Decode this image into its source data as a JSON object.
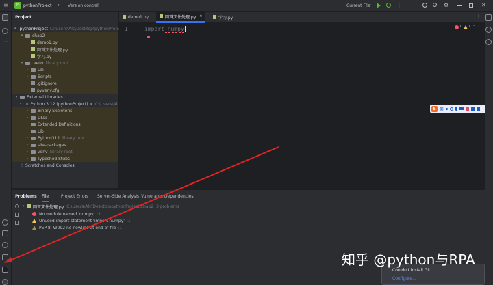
{
  "titlebar": {
    "project": "pythonProject",
    "vcs": "Version control",
    "run_config": "Current File"
  },
  "project_panel": {
    "title": "Project",
    "tree": [
      {
        "label": "pythonProject",
        "hint": "C:\\Users\\Alc\\Desktop\\pythonProject"
      },
      {
        "label": "chap2"
      },
      {
        "label": "demo1.py"
      },
      {
        "label": "回首文件处理.py"
      },
      {
        "label": "学习.py"
      },
      {
        "label": ".venv",
        "hint": "library root"
      },
      {
        "label": "Lib"
      },
      {
        "label": "Scripts"
      },
      {
        "label": ".gitignore"
      },
      {
        "label": "pyvenv.cfg"
      },
      {
        "label": "External Libraries"
      },
      {
        "label": "< Python 3.12 (pythonProject) >",
        "hint": "C:\\Users\\Alc\\Desk"
      },
      {
        "label": "Binary Skeletons"
      },
      {
        "label": "DLLs"
      },
      {
        "label": "Extended Definitions"
      },
      {
        "label": "Lib"
      },
      {
        "label": "Python312",
        "hint": "library root"
      },
      {
        "label": "site-packages"
      },
      {
        "label": "venv",
        "hint": "library root"
      },
      {
        "label": "Typeshed Stubs"
      },
      {
        "label": "Scratches and Consoles"
      }
    ]
  },
  "editor": {
    "tabs": [
      {
        "label": "demo1.py"
      },
      {
        "label": "回首文件处理.py"
      },
      {
        "label": "学习.py"
      }
    ],
    "line_number": "1",
    "code": "import numpy",
    "errors": "1",
    "warnings": "1"
  },
  "ime_bar": {
    "label": "英"
  },
  "problems": {
    "tabs": [
      "Problems",
      "File",
      "Project Errors",
      "Server-Side Analysis",
      "Vulnerable Dependencies"
    ],
    "file": {
      "name": "回首文件处理.py",
      "path": "C:\\Users\\Alc\\Desktop\\pythonProject\\chap2",
      "count": "3 problems"
    },
    "items": [
      {
        "text": "No module named 'numpy'",
        "line": ":1"
      },
      {
        "text": "Unused import statement 'import numpy'",
        "line": ":1"
      },
      {
        "text": "PEP 8: W292 no newline at end of file",
        "line": ":1"
      }
    ]
  },
  "popup": {
    "line1": "Couldn't install Git",
    "link": "Configure..."
  },
  "watermark": "知乎 @python与RPA",
  "colors": {
    "accent": "#3574f0",
    "error": "#f75464",
    "warning": "#f2c55c",
    "highlight": "#3b3524",
    "watermark": "#ffffff"
  }
}
